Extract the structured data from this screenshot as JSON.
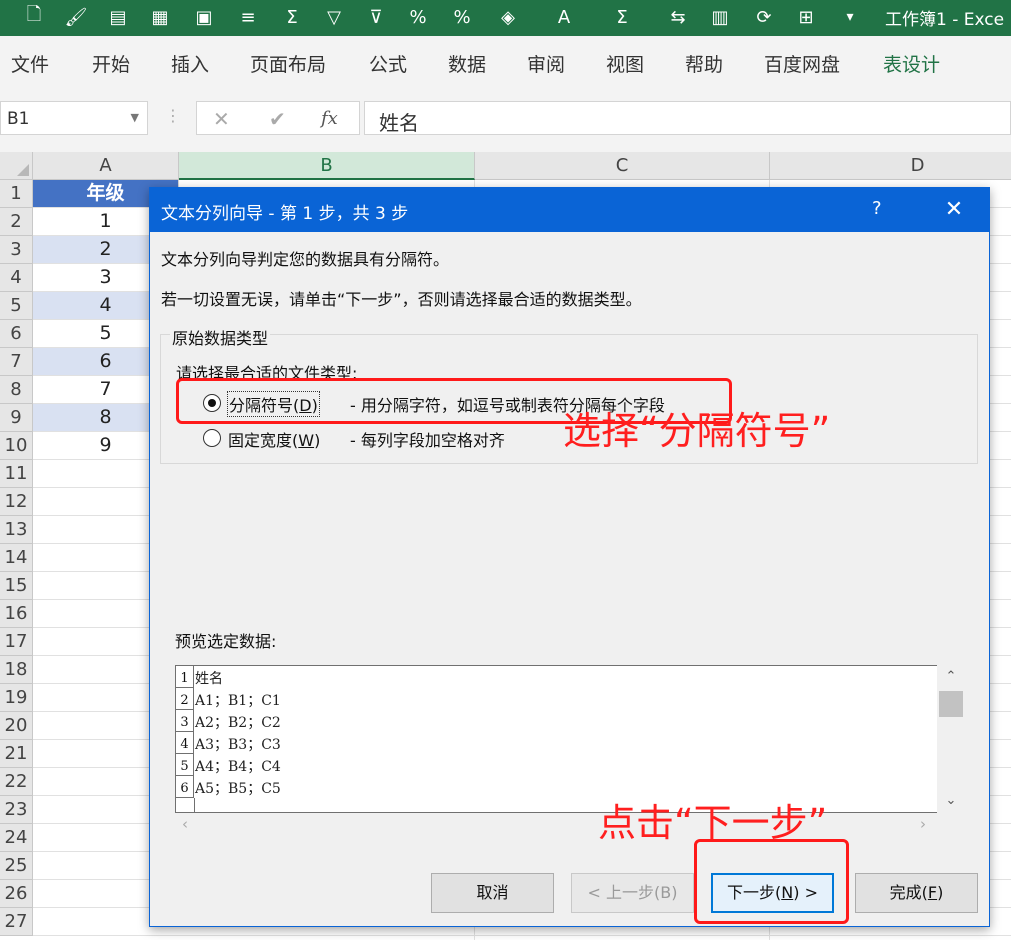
{
  "window": {
    "title": "工作簿1 -  Exce",
    "toolbar_icons": [
      "file-icon",
      "format-painter-icon",
      "table-icon",
      "grid-icon",
      "film-icon",
      "align-icon",
      "sum-icon",
      "filter-icon",
      "clear-filter-icon",
      "percent-decimal-icon",
      "percent-icon",
      "fill-color-icon",
      "font-color-icon",
      "autosum-icon",
      "text-to-columns-icon",
      "freeze-icon",
      "refresh-icon",
      "borders-icon",
      "more-icon"
    ]
  },
  "ribbon": {
    "tabs": [
      "文件",
      "开始",
      "插入",
      "页面布局",
      "公式",
      "数据",
      "审阅",
      "视图",
      "帮助",
      "百度网盘",
      "表设计"
    ]
  },
  "formula_bar": {
    "name_box": "B1",
    "cancel_glyph": "✕",
    "confirm_glyph": "✔",
    "fx_glyph": "fx",
    "value": "姓名"
  },
  "sheet": {
    "columns": [
      "A",
      "B",
      "C",
      "D"
    ],
    "rows": [
      "1",
      "2",
      "3",
      "4",
      "5",
      "6",
      "7",
      "8",
      "9",
      "10",
      "11",
      "12",
      "13",
      "14",
      "15",
      "16",
      "17",
      "18",
      "19",
      "20",
      "21",
      "22",
      "23",
      "24",
      "25",
      "26",
      "27"
    ],
    "col_a_header": "年级",
    "col_a_values": [
      "1",
      "2",
      "3",
      "4",
      "5",
      "6",
      "7",
      "8",
      "9"
    ]
  },
  "dialog": {
    "title": "文本分列向导 - 第 1 步，共 3 步",
    "help": "?",
    "close": "✕",
    "line1": "文本分列向导判定您的数据具有分隔符。",
    "line2": "若一切设置无误，请单击“下一步”，否则请选择最合适的数据类型。",
    "group_title": "原始数据类型",
    "group_prompt": "请选择最合适的文件类型:",
    "option1_pre": "分隔符号(",
    "option1_key": "D",
    "option1_post": ")",
    "option1_desc": "- 用分隔字符，如逗号或制表符分隔每个字段",
    "option2_pre": "固定宽度(",
    "option2_key": "W",
    "option2_post": ")",
    "option2_desc": "- 每列字段加空格对齐",
    "preview_label": "预览选定数据:",
    "preview_rows": [
      {
        "num": "1",
        "text": "姓名"
      },
      {
        "num": "2",
        "text": "A1；B1；C1"
      },
      {
        "num": "3",
        "text": "A2；B2；C2"
      },
      {
        "num": "4",
        "text": "A3；B3；C3"
      },
      {
        "num": "5",
        "text": "A4；B4；C4"
      },
      {
        "num": "6",
        "text": "A5；B5；C5"
      }
    ],
    "buttons": {
      "cancel": "取消",
      "back": "< 上一步(B)",
      "next_pre": "下一步(",
      "next_key": "N",
      "next_post": ") >",
      "finish_pre": "完成(",
      "finish_key": "F",
      "finish_post": ")"
    }
  },
  "annotations": {
    "select_text": "选择“分隔符号”",
    "click_text": "点击“下一步”",
    "color": "#ff1f1f"
  }
}
